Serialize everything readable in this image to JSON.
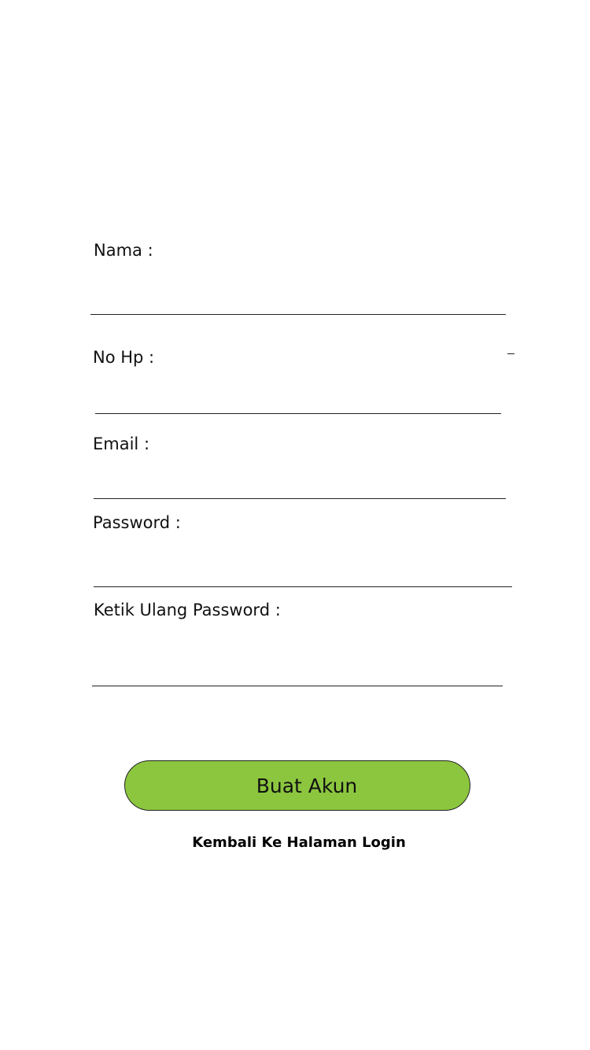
{
  "form": {
    "fields": [
      {
        "label": "Nama :",
        "value": "",
        "placeholder": ""
      },
      {
        "label": "No Hp :",
        "value": "",
        "placeholder": ""
      },
      {
        "label": "Email :",
        "value": "",
        "placeholder": ""
      },
      {
        "label": "Password :",
        "value": "",
        "placeholder": ""
      },
      {
        "label": "Ketik Ulang Password :",
        "value": "",
        "placeholder": ""
      }
    ],
    "submit_label": "Buat Akun",
    "back_link_label": "Kembali Ke Halaman Login"
  },
  "colors": {
    "button_fill": "#8cc63f",
    "line": "#222222",
    "text": "#111111"
  }
}
